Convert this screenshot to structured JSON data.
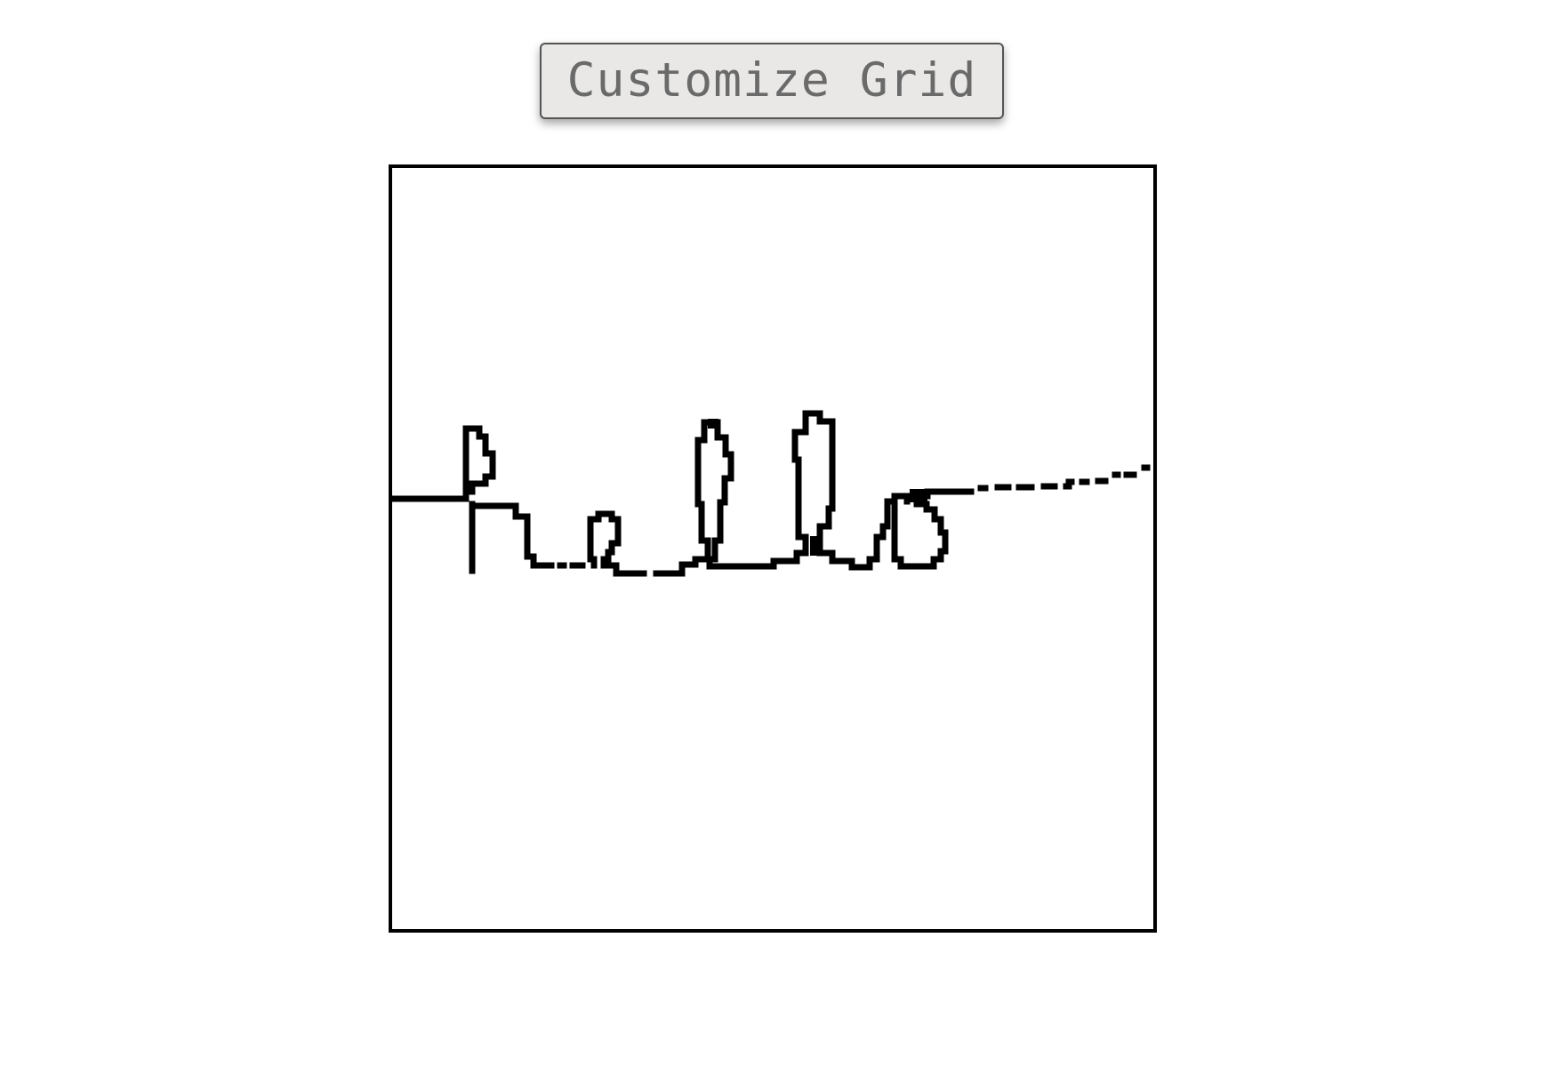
{
  "toolbar": {
    "customize_grid_label": "Customize Grid"
  },
  "canvas": {
    "stroke_color": "#000000",
    "background_color": "#ffffff"
  },
  "colors": {
    "button_background": "#e9e8e6",
    "button_text": "#6a6a6a",
    "frame_border": "#000000"
  }
}
